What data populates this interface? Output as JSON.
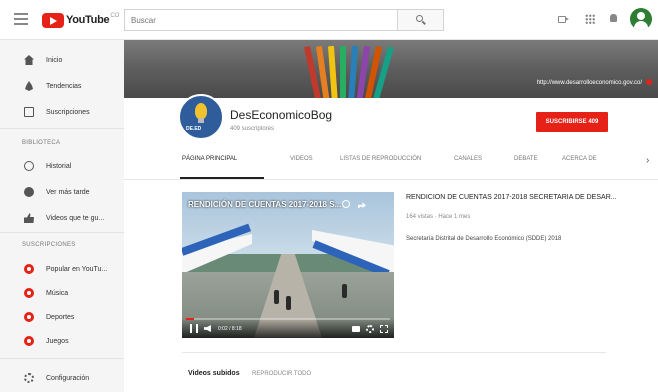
{
  "header": {
    "logo_text": "YouTube",
    "logo_sup": "CO",
    "search_placeholder": "Buscar"
  },
  "sidebar": {
    "main_items": [
      {
        "label": "Inicio",
        "icon": "home-icon"
      },
      {
        "label": "Tendencias",
        "icon": "trending-icon"
      },
      {
        "label": "Suscripciones",
        "icon": "subscriptions-icon"
      }
    ],
    "library_title": "BIBLIOTECA",
    "library_items": [
      {
        "label": "Historial",
        "icon": "history-icon"
      },
      {
        "label": "Ver más tarde",
        "icon": "watch-later-icon"
      },
      {
        "label": "Videos que te gu...",
        "icon": "liked-videos-icon"
      }
    ],
    "subs_title": "SUSCRIPCIONES",
    "subs_items": [
      {
        "label": "Popular en YouTu...",
        "icon": "popular-channel-icon"
      },
      {
        "label": "Música",
        "icon": "music-channel-icon"
      },
      {
        "label": "Deportes",
        "icon": "sports-channel-icon"
      },
      {
        "label": "Juegos",
        "icon": "gaming-channel-icon"
      }
    ],
    "settings_label": "Configuración"
  },
  "banner": {
    "url_text": "http://www.desarrolloeconomico.gov.co/"
  },
  "channel": {
    "name": "DesEconomicoBog",
    "subscribers": "409 suscriptores",
    "subscribe_label": "SUSCRIBIRSE 409",
    "avatar_tag": "DE.ED",
    "tabs": [
      "PÁGINA PRINCIPAL",
      "VIDEOS",
      "LISTAS DE REPRODUCCIÓN",
      "CANALES",
      "DEBATE",
      "ACERCA DE"
    ],
    "active_tab": 0
  },
  "featured": {
    "player_title": "RENDICIÓN DE CUENTAS 2017-2018 S...",
    "time": "0:02 / 8:18",
    "progress": 0.04,
    "title": "RENDICION DE CUENTAS 2017-2018 SECRETARIA DE DESAR...",
    "meta": "164 vistas · Hace 1 mes",
    "description": "Secretaría Distrital de Desarrollo Económico (SDDE) 2018"
  },
  "uploads": {
    "title": "Videos subidos",
    "play_all": "REPRODUCIR TODO"
  },
  "colors": {
    "accent": "#e62117",
    "avatar_green": "#2e7d32"
  }
}
